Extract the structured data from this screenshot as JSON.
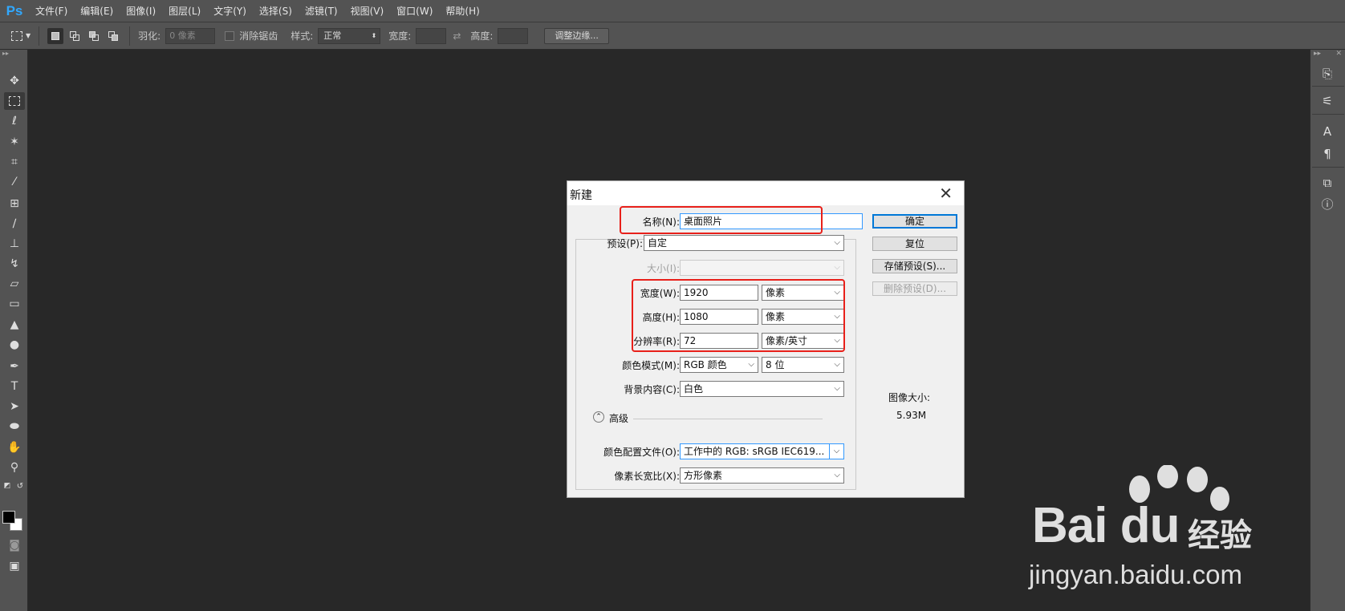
{
  "app": {
    "logo": "Ps"
  },
  "menu": [
    "文件(F)",
    "编辑(E)",
    "图像(I)",
    "图层(L)",
    "文字(Y)",
    "选择(S)",
    "滤镜(T)",
    "视图(V)",
    "窗口(W)",
    "帮助(H)"
  ],
  "options": {
    "feather_label": "羽化:",
    "feather_placeholder": "0 像素",
    "antialias_label": "消除锯齿",
    "style_label": "样式:",
    "style_value": "正常",
    "width_label": "宽度:",
    "height_label": "高度:",
    "refine_button": "调整边缘..."
  },
  "tools": [
    "move-tool",
    "marquee-tool",
    "lasso-tool",
    "magic-wand-tool",
    "crop-tool",
    "eyedropper-tool",
    "healing-brush-tool",
    "brush-tool",
    "clone-stamp-tool",
    "history-brush-tool",
    "eraser-tool",
    "gradient-tool",
    "blur-tool",
    "dodge-tool",
    "pen-tool",
    "type-tool",
    "path-selection-tool",
    "ellipse-tool",
    "hand-tool",
    "zoom-tool"
  ],
  "colors": {
    "foreground": "#000000",
    "background": "#ffffff",
    "highlight": "#e8201a",
    "accent": "#0078d7"
  },
  "dialog": {
    "title": "新建",
    "name_label": "名称(N):",
    "name_value": "桌面照片",
    "preset_label": "预设(P):",
    "preset_value": "自定",
    "size_label": "大小(I):",
    "width_label": "宽度(W):",
    "width_value": "1920",
    "width_unit": "像素",
    "height_label": "高度(H):",
    "height_value": "1080",
    "height_unit": "像素",
    "resolution_label": "分辨率(R):",
    "resolution_value": "72",
    "resolution_unit": "像素/英寸",
    "color_mode_label": "颜色模式(M):",
    "color_mode_value": "RGB 颜色",
    "bit_depth_value": "8 位",
    "background_label": "背景内容(C):",
    "background_value": "白色",
    "advanced_label": "高级",
    "color_profile_label": "颜色配置文件(O):",
    "color_profile_value": "工作中的 RGB: sRGB IEC619...",
    "pixel_aspect_label": "像素长宽比(X):",
    "pixel_aspect_value": "方形像素",
    "ok_button": "确定",
    "reset_button": "复位",
    "save_preset_button": "存储预设(S)...",
    "delete_preset_button": "删除预设(D)...",
    "image_size_label": "图像大小:",
    "image_size_value": "5.93M"
  },
  "watermark": {
    "brand": "Bai du",
    "product": "经验",
    "url": "jingyan.baidu.com"
  }
}
